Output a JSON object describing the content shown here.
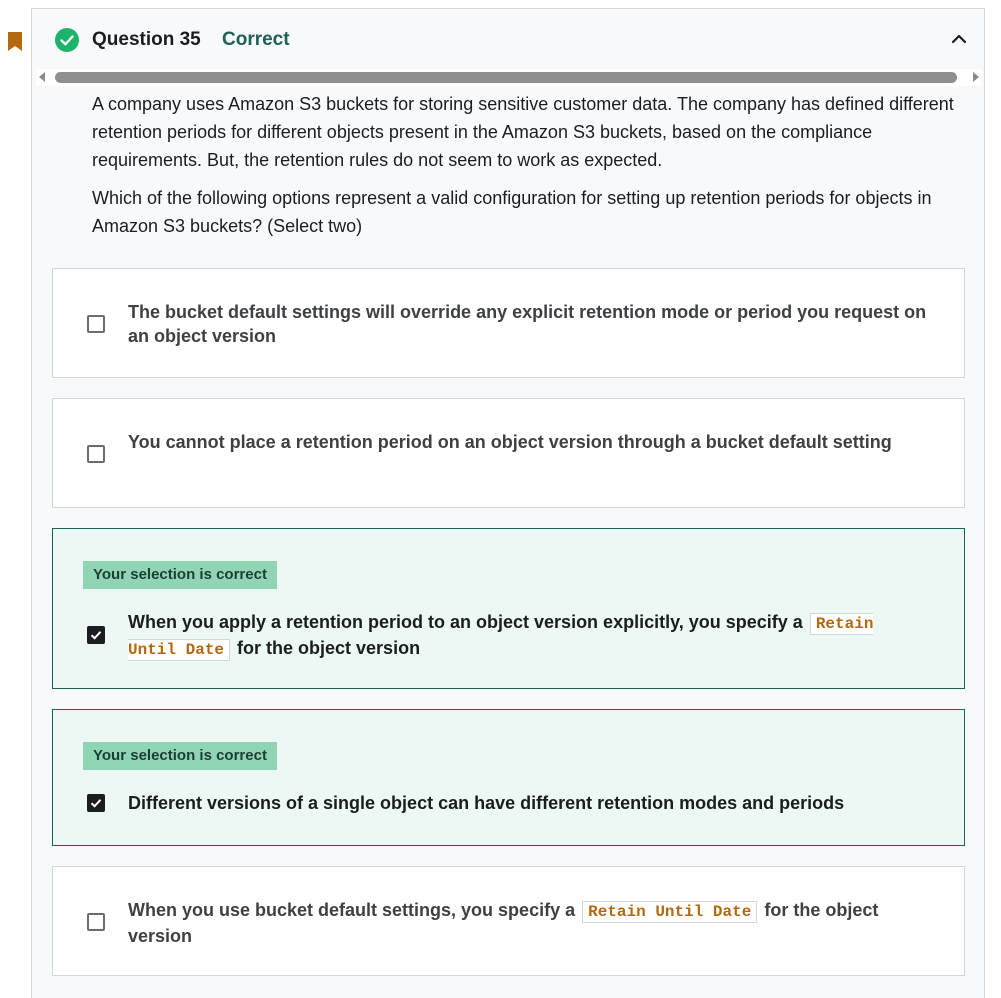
{
  "question": {
    "title": "Question 35",
    "status": "Correct",
    "prompt_p1": "A company uses Amazon S3 buckets for storing sensitive customer data. The company has defined different retention periods for different objects present in the Amazon S3 buckets, based on the compliance requirements. But, the retention rules do not seem to work as expected.",
    "prompt_p2": "Which of the following options represent a valid configuration for setting up retention periods for objects in Amazon S3 buckets? (Select two)"
  },
  "badge_text": "Your selection is correct",
  "options": [
    {
      "text": "The bucket default settings will override any explicit retention mode or period you request on an object version",
      "checked": false
    },
    {
      "text": "You cannot place a retention period on an object version through a bucket default setting",
      "checked": false
    },
    {
      "text_before": "When you apply a retention period to an object version explicitly, you specify a",
      "code": "Retain Until Date",
      "text_after": "for the object version",
      "checked": true
    },
    {
      "text": "Different versions of a single object can have different retention modes and periods",
      "checked": true
    },
    {
      "text_before": "When you use bucket default settings, you specify a",
      "code": "Retain Until Date",
      "text_after": "for the object version",
      "checked": false
    }
  ],
  "icons": {
    "bookmark": "bookmark-icon",
    "status": "check-circle-icon",
    "collapse": "chevron-up-icon"
  },
  "colors": {
    "correct_green": "#1e6055",
    "badge_green": "#8fd5b5",
    "correct_bg": "#ebf8f3",
    "bookmark_orange": "#b4690e",
    "code_orange": "#b4690e"
  }
}
